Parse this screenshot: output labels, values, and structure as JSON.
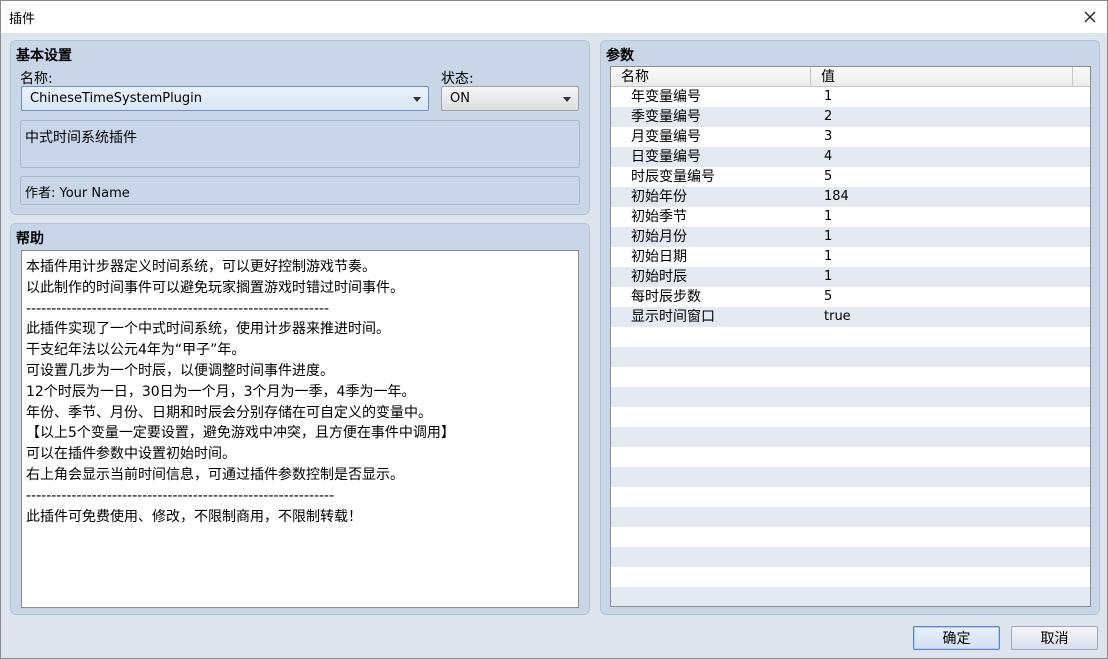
{
  "window": {
    "title": "插件",
    "close_glyph": "×"
  },
  "basic": {
    "title": "基本设置",
    "name_label": "名称:",
    "name_value": "ChineseTimeSystemPlugin",
    "state_label": "状态:",
    "state_value": "ON",
    "description": "中式时间系统插件",
    "author": "作者: Your Name"
  },
  "help": {
    "title": "帮助",
    "text": "本插件用计步器定义时间系统，可以更好控制游戏节奏。\n以此制作的时间事件可以避免玩家搁置游戏时错过时间事件。\n------------------------------------------------------------\n此插件实现了一个中式时间系统，使用计步器来推进时间。\n干支纪年法以公元4年为“甲子”年。\n可设置几步为一个时辰，以便调整时间事件进度。\n12个时辰为一日，30日为一个月，3个月为一季，4季为一年。\n年份、季节、月份、日期和时辰会分别存储在可自定义的变量中。\n【以上5个变量一定要设置，避免游戏中冲突，且方便在事件中调用】\n可以在插件参数中设置初始时间。\n右上角会显示当前时间信息，可通过插件参数控制是否显示。\n-------------------------------------------------------------\n此插件可免费使用、修改，不限制商用，不限制转载！"
  },
  "params": {
    "title": "参数",
    "col_name": "名称",
    "col_value": "值",
    "rows": [
      {
        "name": "年变量编号",
        "value": "1"
      },
      {
        "name": "季变量编号",
        "value": "2"
      },
      {
        "name": "月变量编号",
        "value": "3"
      },
      {
        "name": "日变量编号",
        "value": "4"
      },
      {
        "name": "时辰变量编号",
        "value": "5"
      },
      {
        "name": "初始年份",
        "value": "184"
      },
      {
        "name": "初始季节",
        "value": "1"
      },
      {
        "name": "初始月份",
        "value": "1"
      },
      {
        "name": "初始日期",
        "value": "1"
      },
      {
        "name": "初始时辰",
        "value": "1"
      },
      {
        "name": "每时辰步数",
        "value": "5"
      },
      {
        "name": "显示时间窗口",
        "value": "true"
      }
    ]
  },
  "buttons": {
    "ok": "确定",
    "cancel": "取消"
  }
}
